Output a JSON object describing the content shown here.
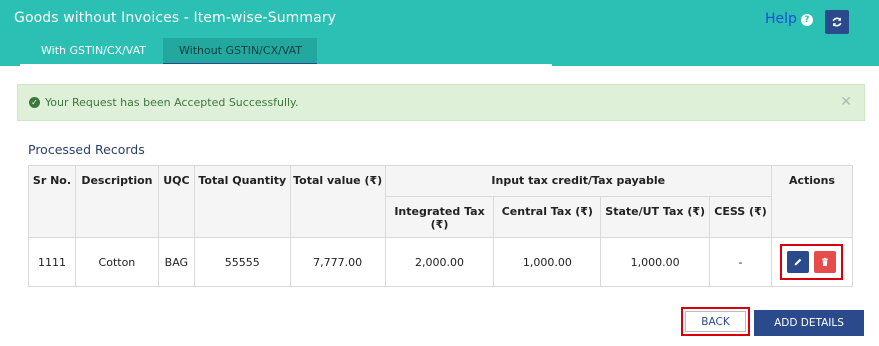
{
  "header": {
    "title": "Goods without Invoices - Item-wise-Summary",
    "help_label": "Help",
    "tabs": [
      {
        "label": "With GSTIN/CX/VAT"
      },
      {
        "label": "Without GSTIN/CX/VAT"
      }
    ]
  },
  "alert": {
    "message": "Your Request has been Accepted Successfully."
  },
  "section": {
    "title": "Processed Records"
  },
  "table": {
    "headers": {
      "sr_no": "Sr No.",
      "description": "Description",
      "uqc": "UQC",
      "total_quantity": "Total Quantity",
      "total_value": "Total value (₹)",
      "itc_group": "Input tax credit/Tax payable",
      "integrated_tax": "Integrated Tax (₹)",
      "central_tax": "Central Tax (₹)",
      "state_ut_tax": "State/UT Tax (₹)",
      "cess": "CESS (₹)",
      "actions": "Actions"
    },
    "rows": [
      {
        "sr_no": "1111",
        "description": "Cotton",
        "uqc": "BAG",
        "total_quantity": "55555",
        "total_value": "7,777.00",
        "integrated_tax": "2,000.00",
        "central_tax": "1,000.00",
        "state_ut_tax": "1,000.00",
        "cess": "-"
      }
    ]
  },
  "footer": {
    "back_label": "BACK",
    "add_details_label": "ADD DETAILS"
  },
  "colors": {
    "header_bg": "#2bc0b3",
    "primary_blue": "#2b4a8b",
    "delete_red": "#e64c4c",
    "success_bg": "#dff0d8",
    "highlight_red": "#d9000d"
  }
}
